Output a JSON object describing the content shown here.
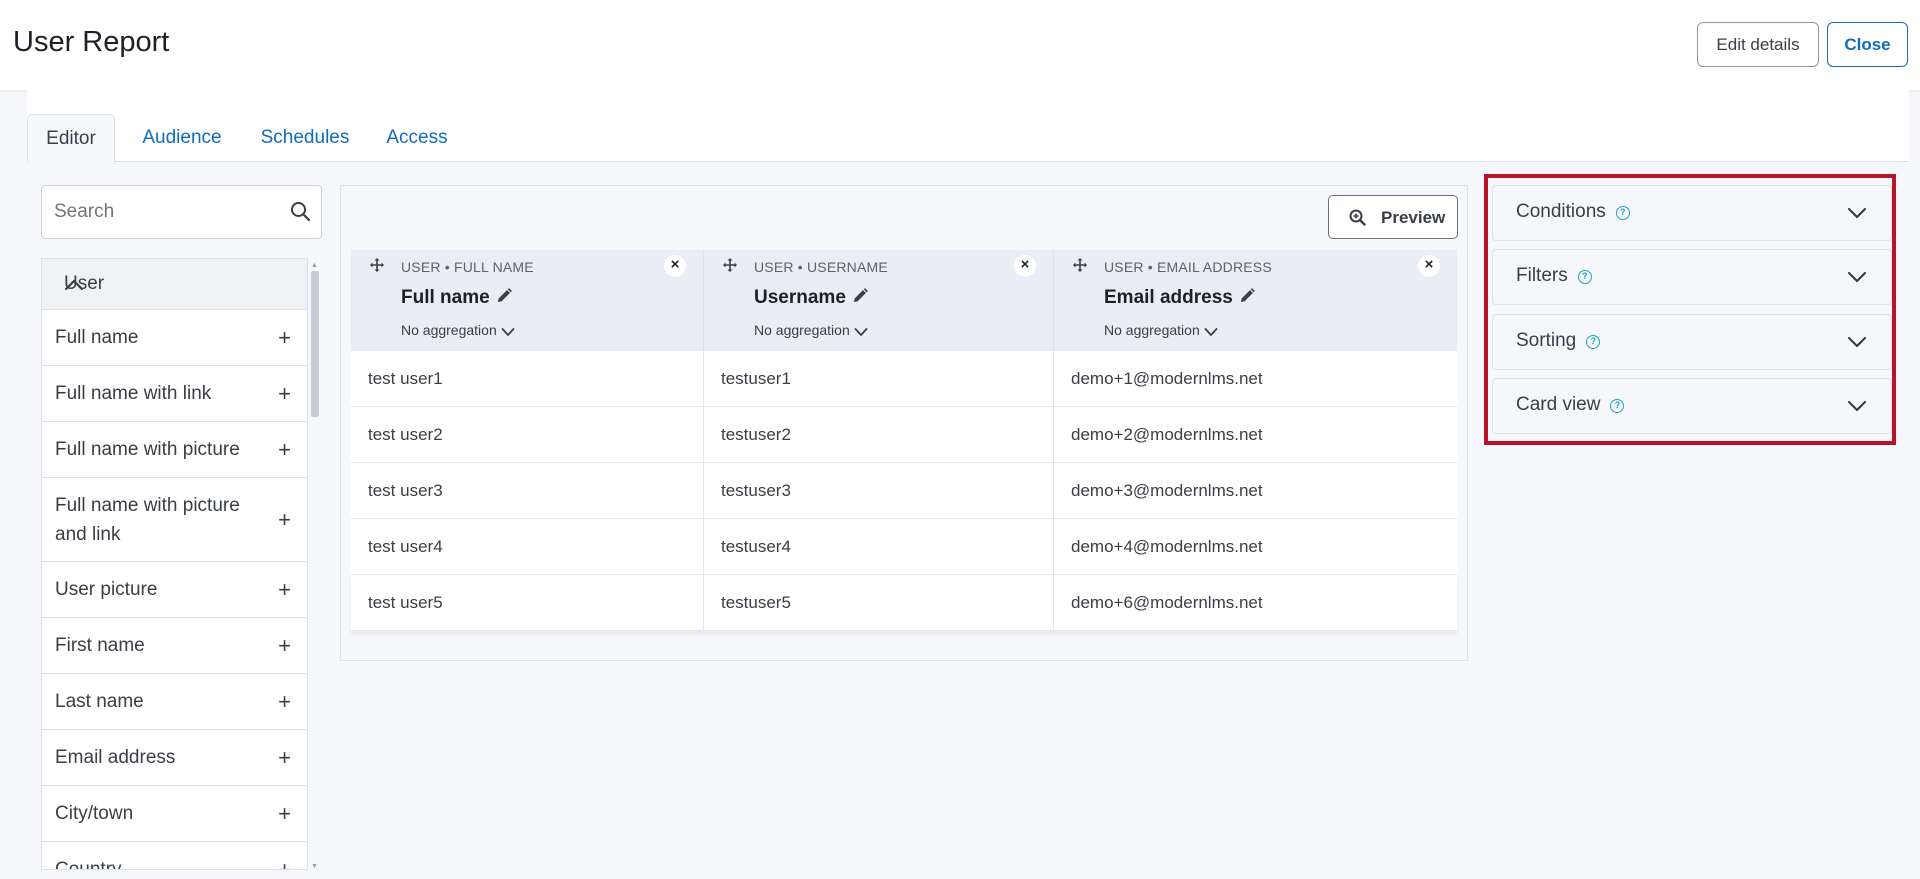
{
  "header": {
    "title": "User Report",
    "edit_button": "Edit details",
    "close_button": "Close"
  },
  "tabs": [
    {
      "label": "Editor",
      "active": true
    },
    {
      "label": "Audience",
      "active": false
    },
    {
      "label": "Schedules",
      "active": false
    },
    {
      "label": "Access",
      "active": false
    }
  ],
  "sidebar": {
    "search_placeholder": "Search",
    "group_title": "User",
    "fields": [
      "Full name",
      "Full name with link",
      "Full name with picture",
      "Full name with picture and link",
      "User picture",
      "First name",
      "Last name",
      "Email address",
      "City/town",
      "Country"
    ]
  },
  "main": {
    "preview_button": "Preview",
    "columns": [
      {
        "source": "USER • FULL NAME",
        "name": "Full name",
        "aggregation": "No aggregation"
      },
      {
        "source": "USER • USERNAME",
        "name": "Username",
        "aggregation": "No aggregation"
      },
      {
        "source": "USER • EMAIL ADDRESS",
        "name": "Email address",
        "aggregation": "No aggregation"
      }
    ],
    "rows": [
      [
        "test user1",
        "testuser1",
        "demo+1@modernlms.net"
      ],
      [
        "test user2",
        "testuser2",
        "demo+2@modernlms.net"
      ],
      [
        "test user3",
        "testuser3",
        "demo+3@modernlms.net"
      ],
      [
        "test user4",
        "testuser4",
        "demo+4@modernlms.net"
      ],
      [
        "test user5",
        "testuser5",
        "demo+6@modernlms.net"
      ]
    ]
  },
  "settings": {
    "sections": [
      "Conditions",
      "Filters",
      "Sorting",
      "Card view"
    ]
  },
  "colors": {
    "accent": "#0f6cbf",
    "highlight_border": "#b6142a",
    "help_icon": "#1ba3c7"
  }
}
